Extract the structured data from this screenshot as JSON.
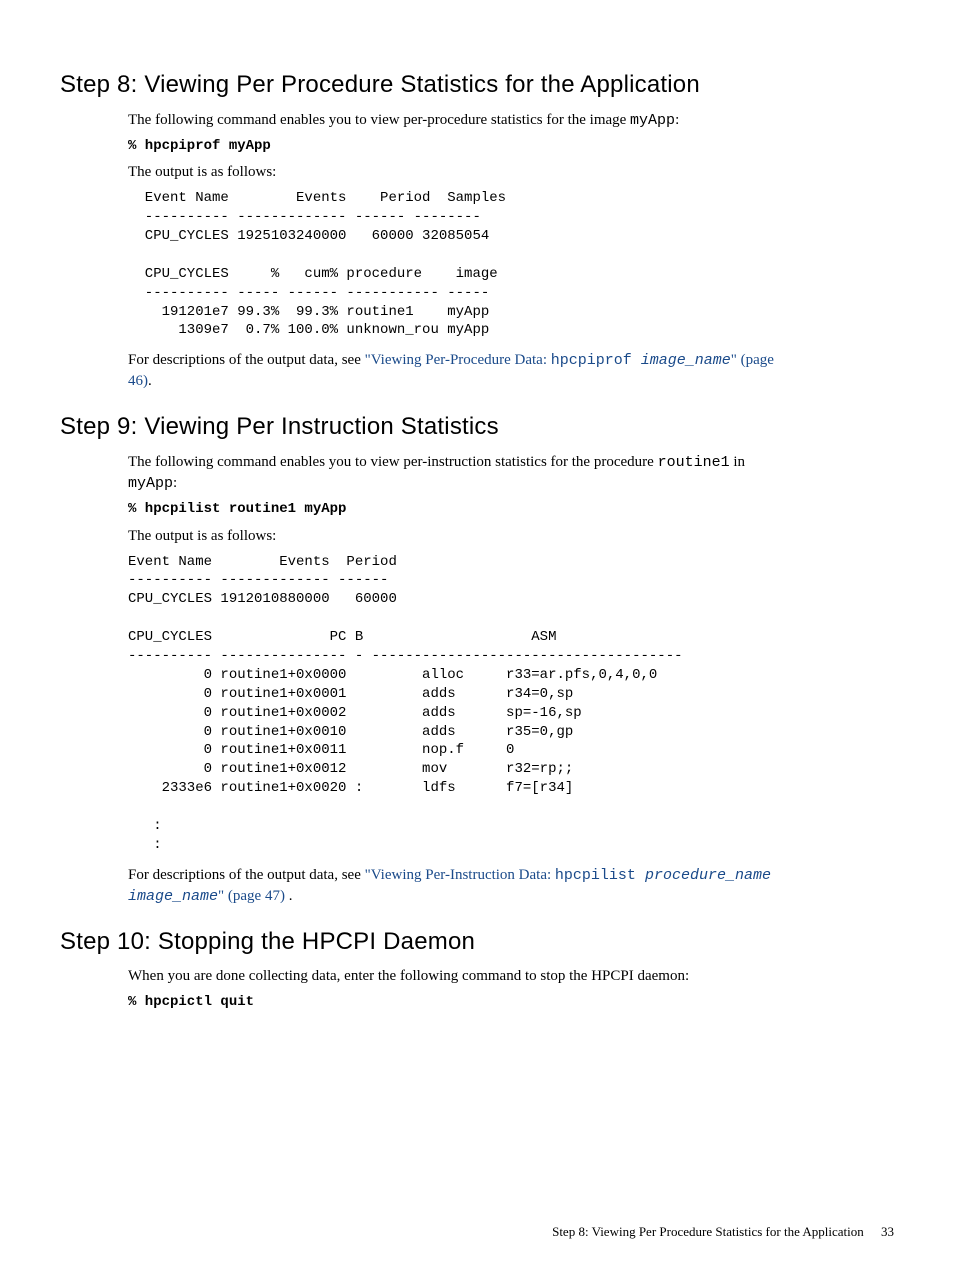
{
  "step8": {
    "heading": "Step 8: Viewing Per Procedure Statistics for the Application",
    "intro_a": "The following command enables you to view per-procedure statistics for the image ",
    "intro_b": "myApp",
    "intro_c": ":",
    "cmd": "% hpcpiprof myApp",
    "out_label": "The output is as follows:",
    "output": "  Event Name        Events    Period  Samples\n  ---------- ------------- ------ --------\n  CPU_CYCLES 1925103240000   60000 32085054\n\n  CPU_CYCLES     %   cum% procedure    image\n  ---------- ----- ------ ----------- -----\n    191201e7 99.3%  99.3% routine1    myApp\n      1309e7  0.7% 100.0% unknown_rou myApp",
    "desc_a": "For descriptions of the output data, see ",
    "desc_link1": "\"Viewing Per-Procedure Data: ",
    "desc_link_mono": "hpcpiprof ",
    "desc_link_ital": "image_name",
    "desc_link2": "\" (page 46)",
    "desc_b": "."
  },
  "step9": {
    "heading": "Step 9: Viewing Per Instruction Statistics",
    "intro_a": "The following command enables you to view per-instruction statistics for the procedure ",
    "intro_b": "routine1",
    "intro_c": " in ",
    "intro_d": "myApp",
    "intro_e": ":",
    "cmd": "% hpcpilist routine1 myApp",
    "out_label": "The output is as follows:",
    "output": "Event Name        Events  Period\n---------- ------------- ------\nCPU_CYCLES 1912010880000   60000\n\nCPU_CYCLES              PC B                    ASM\n---------- --------------- - -------------------------------------\n         0 routine1+0x0000         alloc     r33=ar.pfs,0,4,0,0\n         0 routine1+0x0001         adds      r34=0,sp\n         0 routine1+0x0002         adds      sp=-16,sp\n         0 routine1+0x0010         adds      r35=0,gp\n         0 routine1+0x0011         nop.f     0\n         0 routine1+0x0012         mov       r32=rp;;\n    2333e6 routine1+0x0020 :       ldfs      f7=[r34]\n\n   :\n   :",
    "desc_a": "For descriptions of the output data, see ",
    "desc_link1": "\"Viewing Per-Instruction Data: ",
    "desc_link_mono": "hpcpilist ",
    "desc_link_ital": "procedure_name image_name",
    "desc_link2": "\" (page 47) ",
    "desc_b": "."
  },
  "step10": {
    "heading": "Step 10: Stopping the HPCPI Daemon",
    "intro": "When you are done collecting data, enter the following command to stop the HPCPI daemon:",
    "cmd": "% hpcpictl quit"
  },
  "footer": {
    "text": "Step 8: Viewing Per Procedure Statistics for the Application",
    "page": "33"
  }
}
